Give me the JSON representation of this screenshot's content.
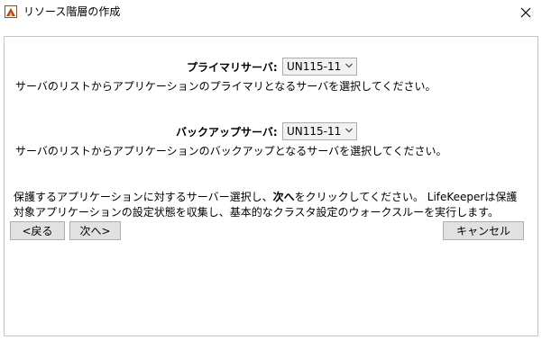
{
  "window": {
    "title": "リソース階層の作成",
    "icon": "app-icon",
    "close_icon": "close-icon"
  },
  "primary": {
    "label": "プライマリサーバ:",
    "selected": "UN115-11",
    "description": "サーバのリストからアプリケーションのプライマリとなるサーバを選択してください。"
  },
  "backup": {
    "label": "バックアップサーバ:",
    "selected": "UN115-11",
    "description": "サーバのリストからアプリケーションのバックアップとなるサーバを選択してください。"
  },
  "info": {
    "line1_prefix": "保護するアプリケーションに対するサーバー選択し、",
    "line1_bold": "次へ",
    "line1_suffix": "をクリックしてください。 LifeKeeperは保護",
    "line2": "対象アプリケーションの設定状態を収集し、基本的なクラスタ設定のウォークスルーを実行します。"
  },
  "buttons": {
    "back": "<戻る",
    "next": "次へ>",
    "cancel": "キャンセル"
  }
}
